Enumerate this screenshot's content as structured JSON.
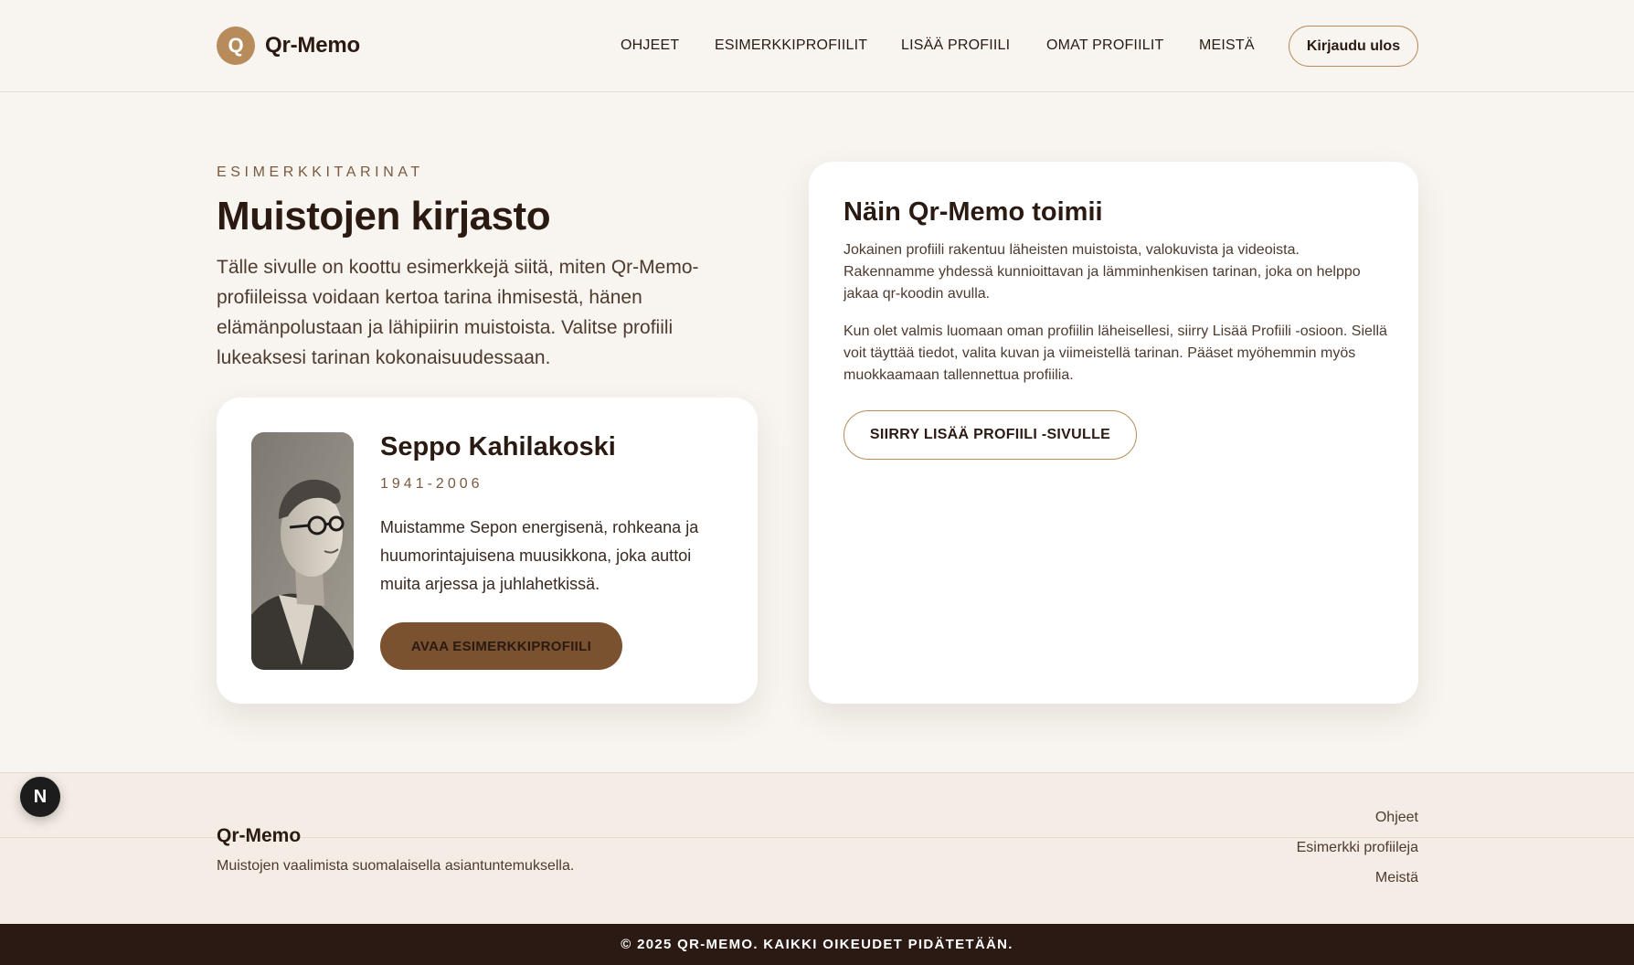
{
  "brand": {
    "logo_letter": "Q",
    "name": "Qr-Memo",
    "accent_color": "#b88b5a"
  },
  "nav": {
    "items": [
      {
        "label": "OHJEET"
      },
      {
        "label": "ESIMERKKIPROFIILIT"
      },
      {
        "label": "LISÄÄ PROFIILI"
      },
      {
        "label": "OMAT PROFIILIT"
      },
      {
        "label": "MEISTÄ"
      }
    ],
    "logout_label": "Kirjaudu ulos"
  },
  "hero": {
    "eyebrow": "ESIMERKKITARINAT",
    "title": "Muistojen kirjasto",
    "description": "Tälle sivulle on koottu esimerkkejä siitä, miten Qr-Memo-profiileissa voidaan kertoa tarina ihmisestä, hänen elämänpolustaan ja lähipiirin muistoista. Valitse profiili lukeaksesi tarinan kokonaisuudessaan."
  },
  "profile_card": {
    "name": "Seppo Kahilakoski",
    "years": "1941-2006",
    "description": "Muistamme Sepon energisenä, rohkeana ja huumorintajuisena muusikkona, joka auttoi muita arjessa ja juhlahetkissä.",
    "button_label": "AVAA ESIMERKKIPROFIILI"
  },
  "info_card": {
    "title": "Näin Qr-Memo toimii",
    "paragraph_1": "Jokainen profiili rakentuu läheisten muistoista, valokuvista ja videoista. Rakennamme yhdessä kunnioittavan ja lämminhenkisen tarinan, joka on helppo jakaa qr-koodin avulla.",
    "paragraph_2": "Kun olet valmis luomaan oman profiilin läheisellesi, siirry Lisää Profiili -osioon. Siellä voit täyttää tiedot, valita kuvan ja viimeistellä tarinan. Pääset myöhemmin myös muokkaamaan tallennettua profiilia.",
    "button_label": "SIIRRY LISÄÄ PROFIILI -SIVULLE"
  },
  "footer": {
    "brand": "Qr-Memo",
    "tagline": "Muistojen vaalimista suomalaisella asiantuntemuksella.",
    "links": [
      {
        "label": "Ohjeet"
      },
      {
        "label": "Esimerkki profiileja"
      },
      {
        "label": "Meistä"
      }
    ],
    "copyright": "© 2025 QR-MEMO. KAIKKI OIKEUDET PIDÄTETÄÄN."
  },
  "dev_badge": {
    "letter": "N"
  }
}
